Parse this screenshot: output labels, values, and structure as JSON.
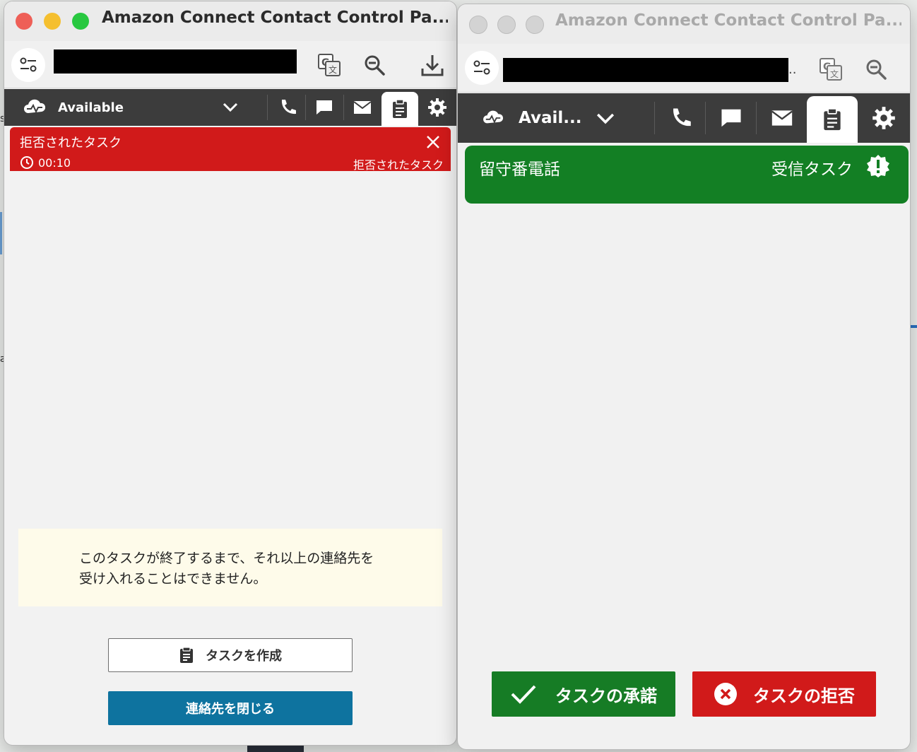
{
  "window_left": {
    "title": "Amazon Connect Contact Control Pa...",
    "agent_status": "Available",
    "task_banner": {
      "title": "拒否されたタスク",
      "timer": "00:10",
      "state_label": "拒否されたタスク"
    },
    "notice_line1": "このタスクが終了するまで、それ以上の連絡先を",
    "notice_line2": "受け入れることはできません。",
    "create_task_label": "タスクを作成",
    "close_contact_label": "連絡先を閉じる"
  },
  "window_right": {
    "title": "Amazon Connect Contact Control Pa...",
    "url_ellipsis": "..",
    "agent_status": "Avail...",
    "task_banner": {
      "title": "留守番電話",
      "state_label": "受信タスク"
    },
    "accept_label": "タスクの承諾",
    "reject_label": "タスクの拒否"
  },
  "colors": {
    "nav_bg": "#3c3c3c",
    "rejected_red": "#d11a1a",
    "incoming_green": "#137f24",
    "close_blue": "#0e739f",
    "notice_bg": "#fefbea"
  },
  "icons": [
    "settings-sliders-icon",
    "translate-icon",
    "zoom-out-icon",
    "download-icon",
    "cloud-status-icon",
    "chevron-down-icon",
    "phone-icon",
    "chat-icon",
    "email-icon",
    "task-icon",
    "gear-icon",
    "clock-icon",
    "close-icon",
    "alert-badge-icon",
    "checkmark-icon",
    "reject-x-icon"
  ]
}
